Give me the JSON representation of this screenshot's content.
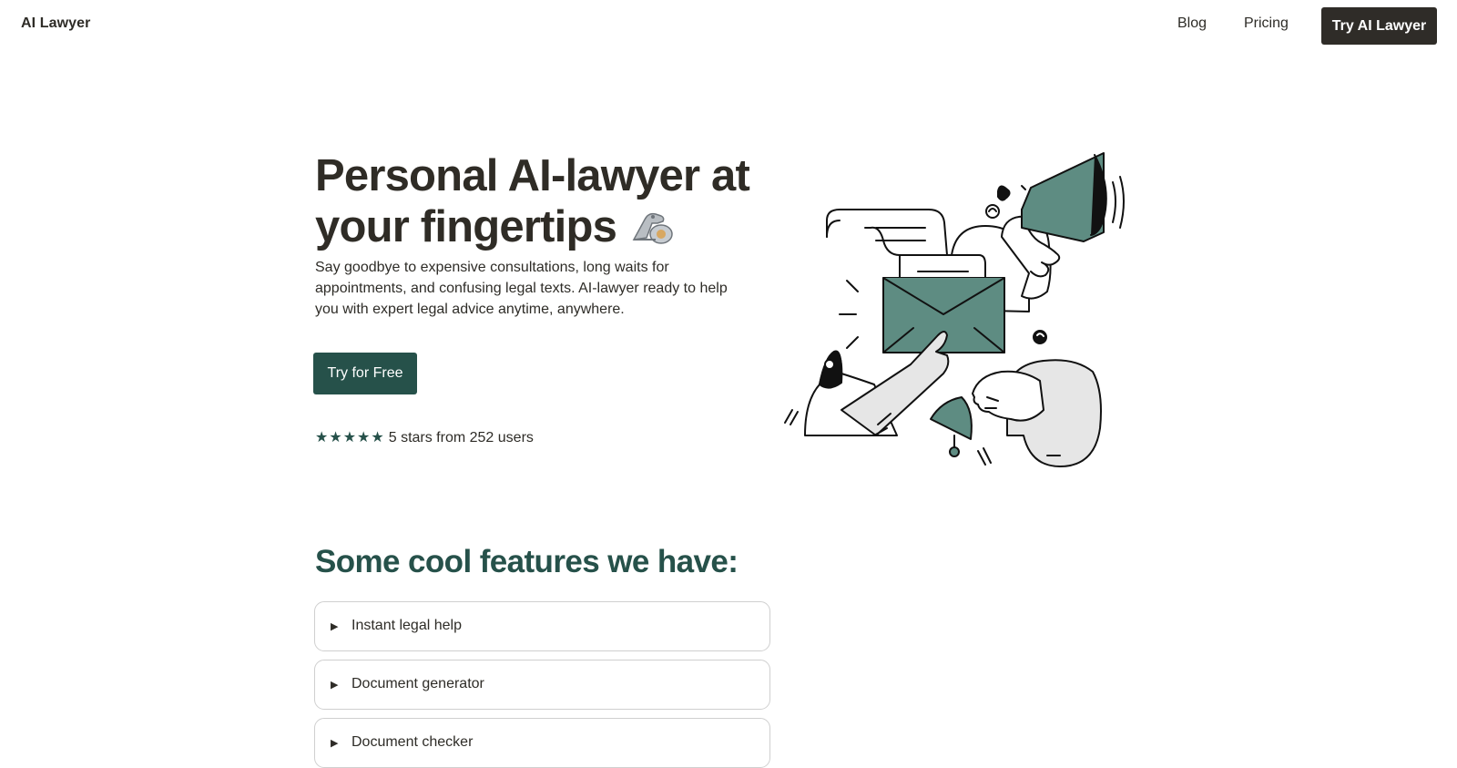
{
  "nav": {
    "brand": "AI Lawyer",
    "links": [
      "Blog",
      "Pricing"
    ],
    "cta": "Try AI Lawyer"
  },
  "hero": {
    "title": "Personal AI-lawyer at your fingertips",
    "subtitle": "Say goodbye to expensive consultations, long waits for appointments, and confusing legal texts. AI-lawyer ready to help you with expert legal advice anytime, anywhere.",
    "cta": "Try for Free",
    "stars": "★★★★★",
    "rating_text": "5 stars from 252 users",
    "rating_value": 5,
    "emoji_icon": "mechanical-arm-icon"
  },
  "features": {
    "title": "Some cool features we have:",
    "items": [
      "Instant legal help",
      "Document generator",
      "Document checker"
    ]
  },
  "colors": {
    "brand_green": "#26514a",
    "illustration_teal": "#5e8c82",
    "dark": "#2f2c28"
  }
}
